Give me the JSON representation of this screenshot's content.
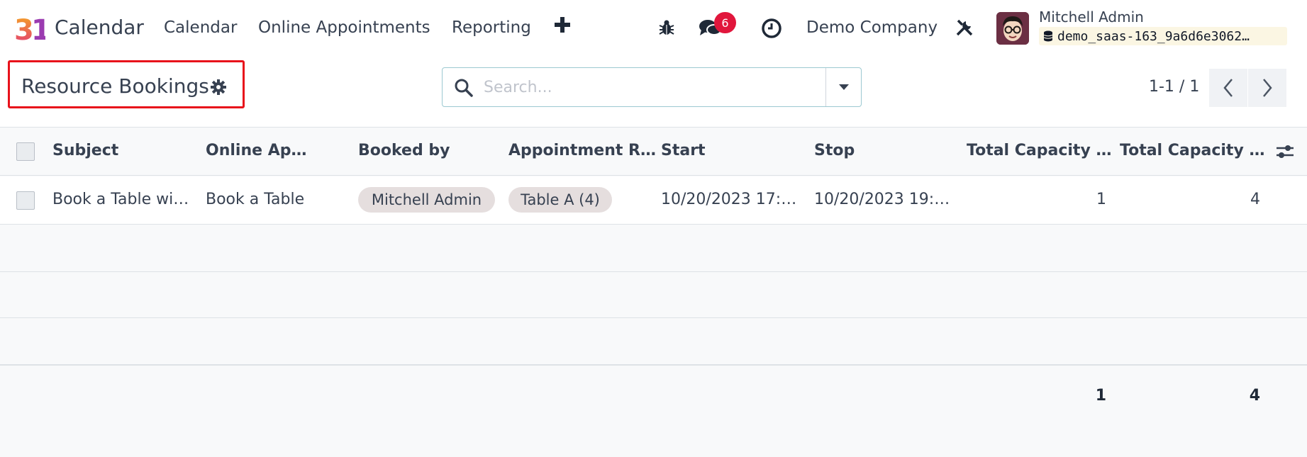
{
  "navbar": {
    "app_name": "Calendar",
    "menus": [
      "Calendar",
      "Online Appointments",
      "Reporting"
    ],
    "messages_count": "6",
    "company": "Demo Company",
    "user_name": "Mitchell Admin",
    "db_name": "demo_saas-163_9a6d6e3062…",
    "icons": [
      "bug-icon",
      "chat-icon",
      "clock-icon",
      "tools-icon",
      "database-icon"
    ]
  },
  "control_panel": {
    "title": "Resource Bookings",
    "search_placeholder": "Search...",
    "pager": "1-1 / 1"
  },
  "table": {
    "headers": [
      "Subject",
      "Online Ap…",
      "Booked by",
      "Appointment R…",
      "Start",
      "Stop",
      "Total Capacity …",
      "Total Capacity …"
    ],
    "rows": [
      {
        "subject": "Book a Table wi…",
        "online_appointment": "Book a Table",
        "booked_by": "Mitchell Admin",
        "resource": "Table A (4)",
        "start": "10/20/2023 17:…",
        "stop": "10/20/2023 19:…",
        "capacity_reserved": "1",
        "capacity": "4"
      }
    ],
    "totals": {
      "capacity_reserved": "1",
      "capacity": "4"
    }
  },
  "colors": {
    "badge": "#e1163c",
    "highlight": "#e8121b",
    "tag_bg": "#e5dede"
  }
}
